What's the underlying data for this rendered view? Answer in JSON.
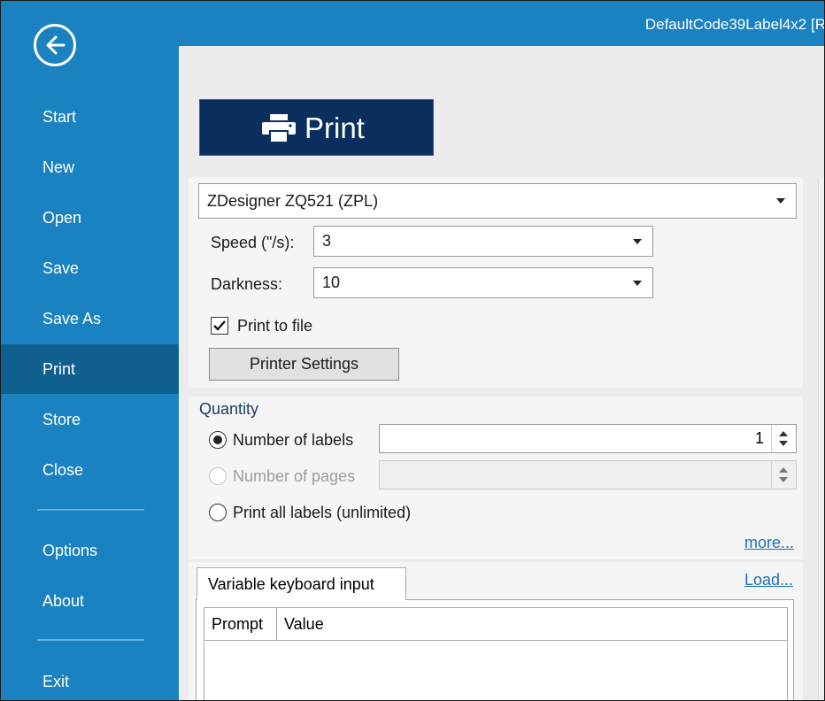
{
  "window": {
    "title": "DefaultCode39Label4x2 [R"
  },
  "sidebar": {
    "items": [
      {
        "label": "Start"
      },
      {
        "label": "New"
      },
      {
        "label": "Open"
      },
      {
        "label": "Save"
      },
      {
        "label": "Save As"
      },
      {
        "label": "Print"
      },
      {
        "label": "Store"
      },
      {
        "label": "Close"
      },
      {
        "label": "Options"
      },
      {
        "label": "About"
      },
      {
        "label": "Exit"
      }
    ],
    "active": "Print"
  },
  "print_button": {
    "label": "Print"
  },
  "printer": {
    "selected": "ZDesigner ZQ521 (ZPL)",
    "speed_label": "Speed (\"/s):",
    "speed_value": "3",
    "darkness_label": "Darkness:",
    "darkness_value": "10",
    "print_to_file_label": "Print to file",
    "print_to_file_checked": true,
    "settings_button": "Printer Settings"
  },
  "quantity": {
    "heading": "Quantity",
    "number_of_labels": "Number of labels",
    "number_of_labels_value": "1",
    "number_of_pages": "Number of pages",
    "print_all": "Print all labels (unlimited)",
    "more_link": "more..."
  },
  "variables": {
    "tab_label": "Variable keyboard input",
    "load_link": "Load...",
    "columns": [
      "Prompt",
      "Value"
    ]
  },
  "colors": {
    "sidebar": "#1a82c0",
    "sidebar_active": "#0f5f8f",
    "print_button": "#0a2f5e",
    "link": "#1f6fb8"
  }
}
